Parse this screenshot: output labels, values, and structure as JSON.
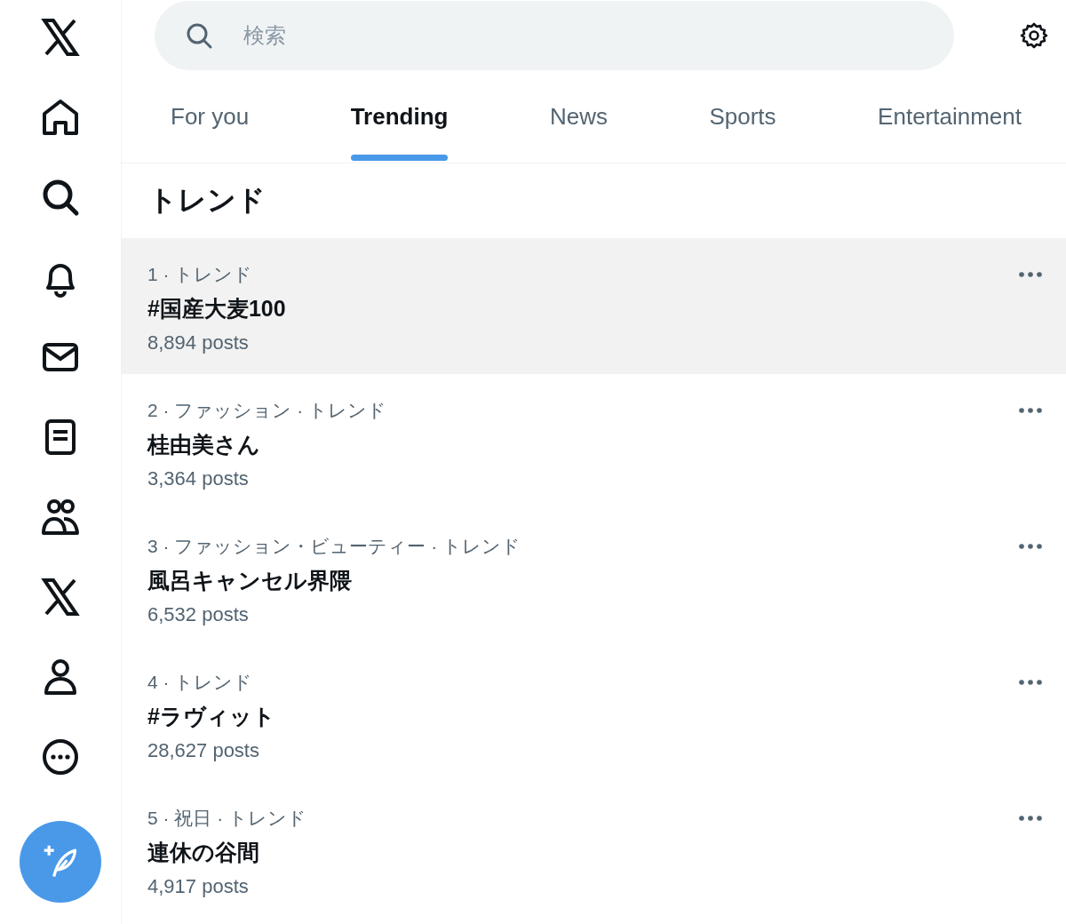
{
  "search": {
    "placeholder": "検索"
  },
  "tabs": [
    {
      "label": "For you",
      "selected": false
    },
    {
      "label": "Trending",
      "selected": true
    },
    {
      "label": "News",
      "selected": false
    },
    {
      "label": "Sports",
      "selected": false
    },
    {
      "label": "Entertainment",
      "selected": false
    }
  ],
  "heading": "トレンド",
  "trends": [
    {
      "meta": "1 · トレンド",
      "title": "#国産大麦100",
      "posts": "8,894 posts",
      "highlighted": true
    },
    {
      "meta": "2 · ファッション · トレンド",
      "title": "桂由美さん",
      "posts": "3,364 posts",
      "highlighted": false
    },
    {
      "meta": "3 · ファッション・ビューティー · トレンド",
      "title": "風呂キャンセル界隈",
      "posts": "6,532 posts",
      "highlighted": false
    },
    {
      "meta": "4 · トレンド",
      "title": "#ラヴィット",
      "posts": "28,627 posts",
      "highlighted": false
    },
    {
      "meta": "5 · 祝日 · トレンド",
      "title": "連休の谷間",
      "posts": "4,917 posts",
      "highlighted": false
    }
  ]
}
